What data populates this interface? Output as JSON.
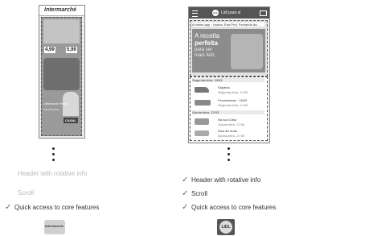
{
  "left": {
    "brand_logo": "Intermarché",
    "flyer_title": "Vilamoura Festa",
    "flyer_subtitle": "PROMOÇÕES",
    "flyer_price_1": "4,99",
    "flyer_price_2": "5,99",
    "flyer_badge": "CASAL",
    "features": [
      {
        "checked": false,
        "label": "Header with rotative info"
      },
      {
        "checked": false,
        "label": "Scroll"
      },
      {
        "checked": true,
        "label": "Quick access to core features"
      }
    ],
    "logo_label": "Intermarché"
  },
  "right": {
    "app_bar_brand": "LIDL",
    "app_bar_title": "Lidl para si",
    "banner_text": "A minha app · Lisboa, Rua Prof. Fernando da...",
    "hero_line1": "A receita",
    "hero_line2": "perfeita",
    "hero_line3": "para ser",
    "hero_line4": "mais feliz",
    "section_1": "Segunda-feira, 19/03",
    "section_2": "Quinta-feira, 17/03",
    "items": [
      {
        "title": "Sapatos",
        "sub": "Segunda-feira, 14:05"
      },
      {
        "title": "Ferramentas · 19/03",
        "sub": "Segunda-feira, 14:05"
      },
      {
        "title": "Na sua Casa",
        "sub": "Quinta-feira, 17:05"
      },
      {
        "title": "Dica da Sorte",
        "sub": "Quinta-feira, 17:05"
      }
    ],
    "features": [
      {
        "checked": true,
        "label": "Header with rotative info"
      },
      {
        "checked": true,
        "label": "Scroll"
      },
      {
        "checked": true,
        "label": "Quick access to core features"
      }
    ],
    "logo_label": "LIDL"
  },
  "colors": {
    "check": "#666666",
    "faded_text": "#b9b9b9",
    "phone_frame": "#888888",
    "lidl_blue": "#555555"
  }
}
